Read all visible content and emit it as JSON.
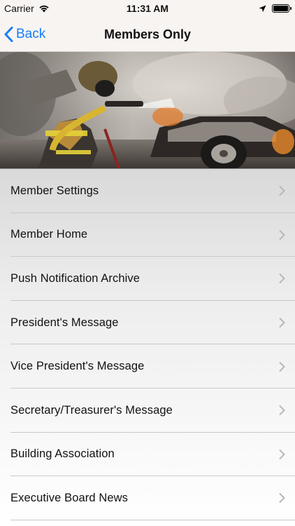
{
  "status_bar": {
    "carrier": "Carrier",
    "time": "11:31 AM"
  },
  "nav": {
    "back_label": "Back",
    "title": "Members Only"
  },
  "banner": {
    "image": "firefighter spraying burning car"
  },
  "menu": {
    "items": [
      {
        "label": "Member Settings"
      },
      {
        "label": "Member Home"
      },
      {
        "label": "Push Notification Archive"
      },
      {
        "label": "President's Message"
      },
      {
        "label": "Vice President's Message"
      },
      {
        "label": "Secretary/Treasurer's Message"
      },
      {
        "label": "Building Association"
      },
      {
        "label": "Executive Board News"
      }
    ]
  },
  "colors": {
    "accent": "#1a7cf5",
    "nav_background": "#f7f4f2"
  }
}
